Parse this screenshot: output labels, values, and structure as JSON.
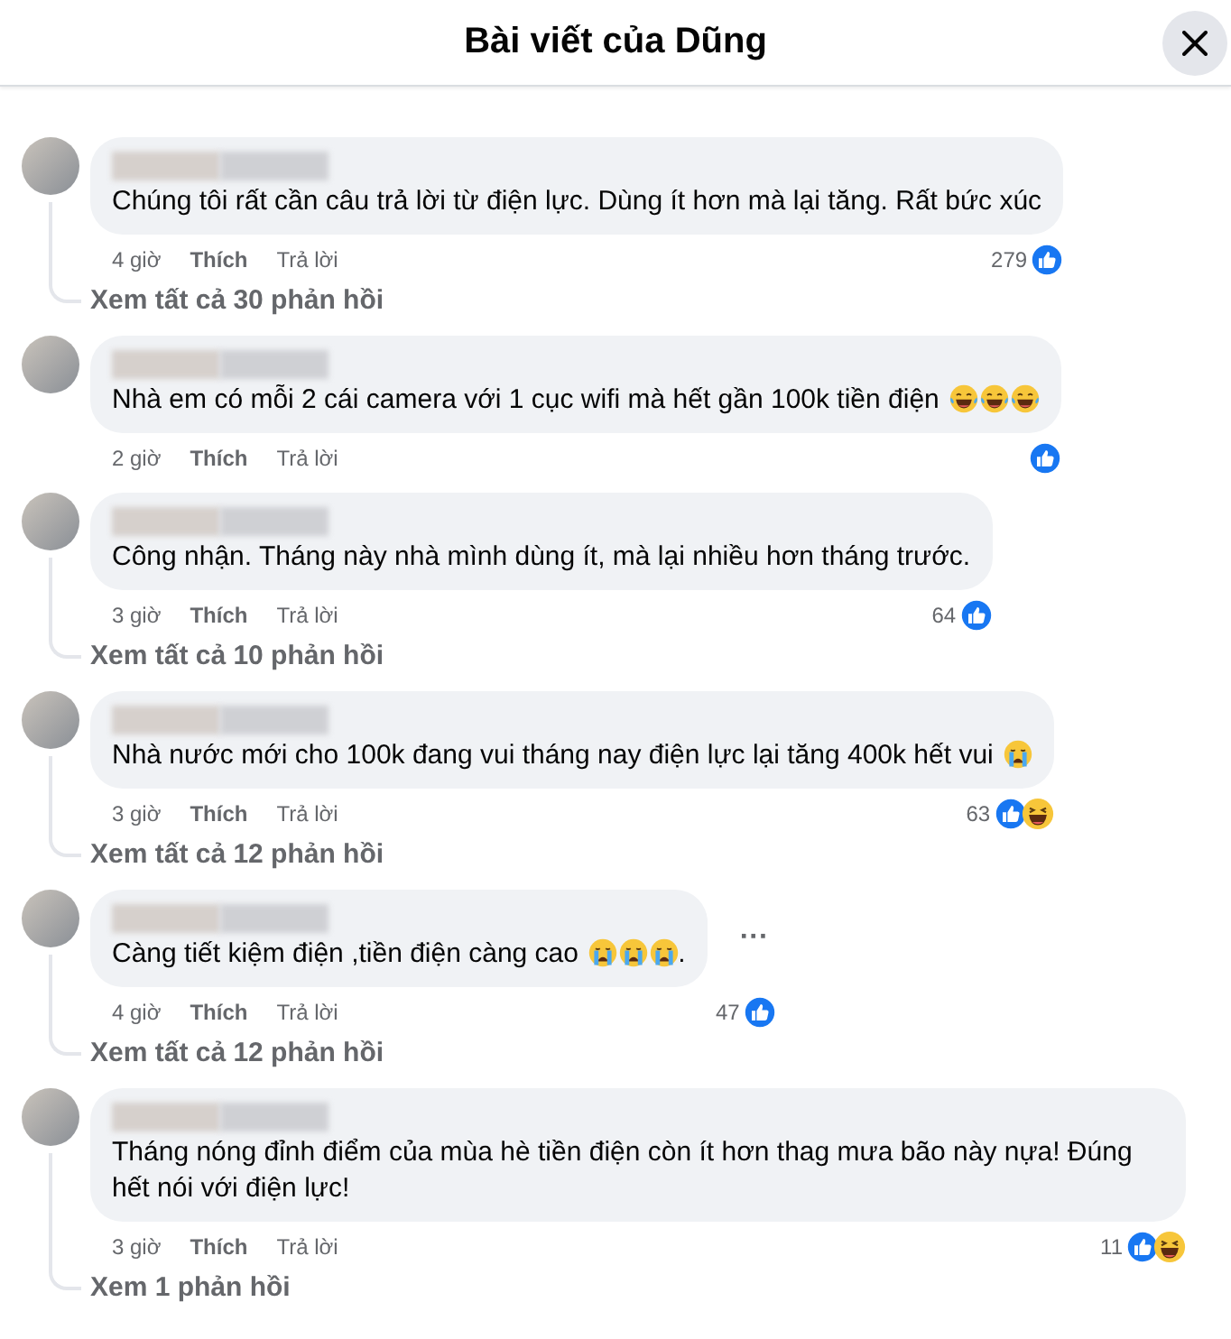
{
  "header": {
    "title": "Bài viết của Dũng"
  },
  "comments": [
    {
      "content": [
        {
          "kind": "text",
          "value": "Chúng tôi rất cần câu trả lời từ điện lực. Dùng ít hơn mà lại tăng. Rất bức xúc"
        }
      ],
      "time": "4 giờ",
      "like": "Thích",
      "reply": "Trả lời",
      "count": "279",
      "reactions": [
        {
          "kind": "like"
        }
      ],
      "replies": "Xem tất cả 30 phản hồi"
    },
    {
      "content": [
        {
          "kind": "text",
          "value": "Nhà em có mỗi 2 cái camera với 1 cục wifi mà hết gần 100k tiền điện "
        },
        {
          "kind": "laugh"
        },
        {
          "kind": "laugh"
        },
        {
          "kind": "laugh"
        }
      ],
      "time": "2 giờ",
      "like": "Thích",
      "reply": "Trả lời",
      "reactions": [
        {
          "kind": "like"
        }
      ]
    },
    {
      "content": [
        {
          "kind": "text",
          "value": "Công nhận. Tháng này nhà mình dùng ít, mà lại nhiều hơn tháng trước."
        }
      ],
      "time": "3 giờ",
      "like": "Thích",
      "reply": "Trả lời",
      "count": "64",
      "reactions": [
        {
          "kind": "like"
        }
      ],
      "replies": "Xem tất cả 10 phản hồi"
    },
    {
      "content": [
        {
          "kind": "text",
          "value": "Nhà nước mới cho 100k đang vui tháng nay điện lực lại tăng 400k hết vui "
        },
        {
          "kind": "cry"
        }
      ],
      "time": "3 giờ",
      "like": "Thích",
      "reply": "Trả lời",
      "count": "63",
      "reactions": [
        {
          "kind": "like"
        },
        {
          "kind": "haha"
        }
      ],
      "replies": "Xem tất cả 12 phản hồi"
    },
    {
      "content": [
        {
          "kind": "text",
          "value": "Càng tiết kiệm điện ,tiền điện càng cao "
        },
        {
          "kind": "cry"
        },
        {
          "kind": "cry"
        },
        {
          "kind": "cry"
        },
        {
          "kind": "text",
          "value": "."
        }
      ],
      "menu": "···",
      "time": "4 giờ",
      "like": "Thích",
      "reply": "Trả lời",
      "count": "47",
      "reactions": [
        {
          "kind": "like"
        }
      ],
      "replies": "Xem tất cả 12 phản hồi"
    },
    {
      "content": [
        {
          "kind": "text",
          "value": "Tháng nóng đỉnh điểm của mùa hè tiền điện còn ít hơn thag mưa bão này nựa! Đúng hết nói với điện lực!"
        }
      ],
      "time": "3 giờ",
      "like": "Thích",
      "reply": "Trả lời",
      "count": "11",
      "reactions": [
        {
          "kind": "like"
        },
        {
          "kind": "haha"
        }
      ],
      "replies": "Xem 1 phản hồi"
    }
  ]
}
